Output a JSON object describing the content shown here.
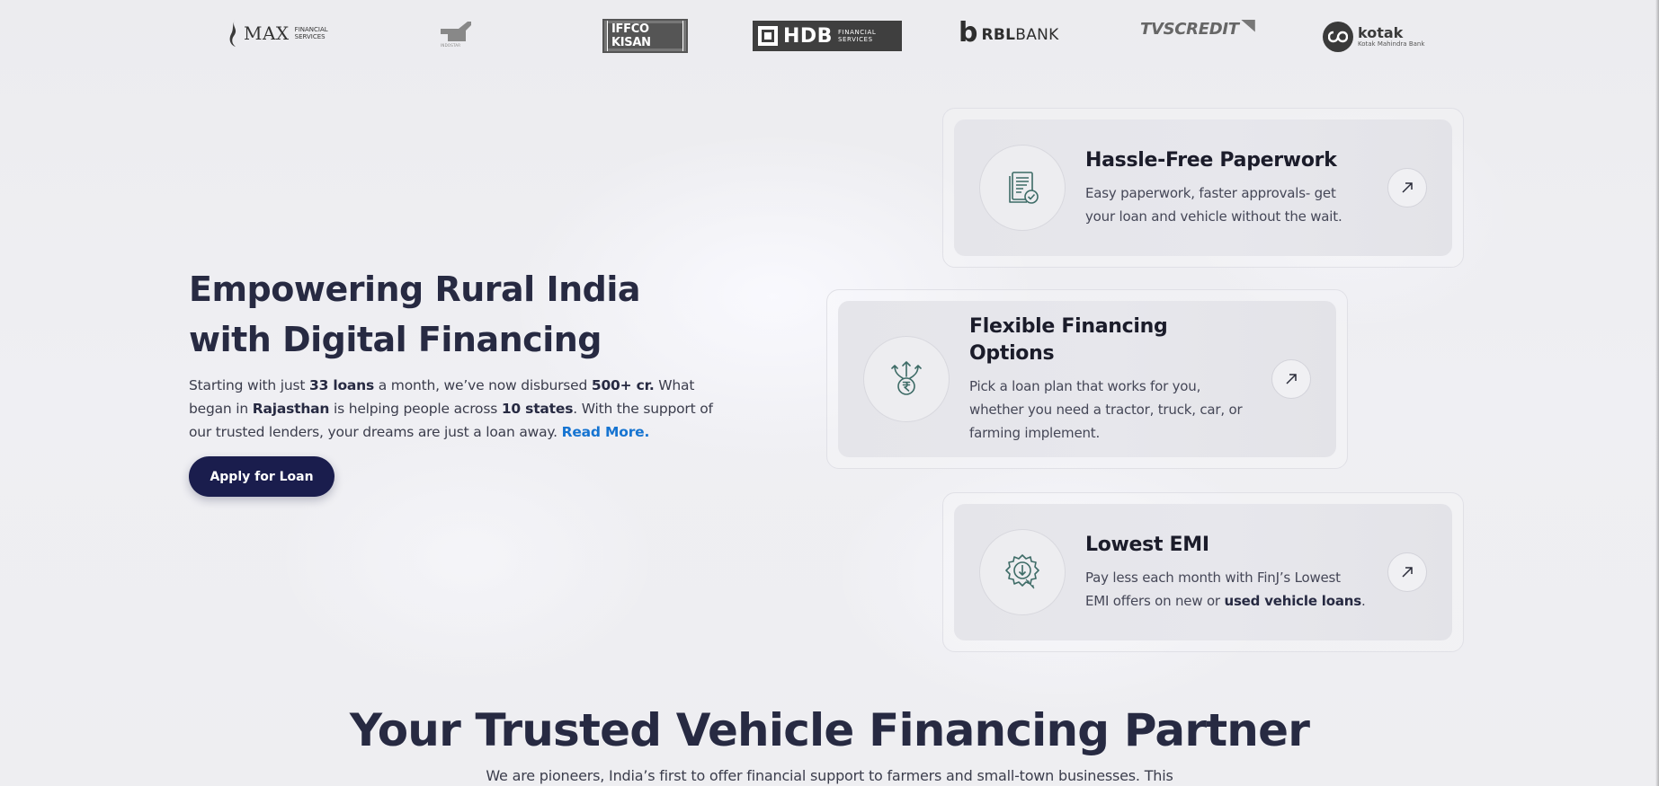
{
  "partners": {
    "max": {
      "name": "MAX",
      "sub_line1": "FINANCIAL",
      "sub_line2": "SERVICES"
    },
    "indostar": {
      "sub": "INDOSTAR"
    },
    "iffco": {
      "name": "IFFCO KISAN"
    },
    "hdb": {
      "name": "HDB",
      "sub_line1": "FINANCIAL",
      "sub_line2": "SERVICES"
    },
    "rbl": {
      "mark": "b",
      "name_bold": "RBL",
      "name_light": "BANK"
    },
    "tvs": {
      "name": "TVSCREDIT"
    },
    "kotak": {
      "name": "kotak",
      "sub": "Kotak Mahindra Bank"
    }
  },
  "hero": {
    "title_line1": "Empowering Rural India",
    "title_line2": "with Digital Financing",
    "desc": {
      "t1": "Starting with just ",
      "b1": "33 loans",
      "t2": " a month, we’ve now disbursed ",
      "b2": "500+ cr.",
      "t3": " What began in ",
      "b3": "Rajasthan",
      "t4": " is helping people across ",
      "b4": "10 states",
      "t5": ". With the support of our trusted lenders, your dreams are just a loan away. ",
      "read_more": "Read More."
    },
    "cta": "Apply for Loan"
  },
  "features": [
    {
      "title": "Hassle-Free Paperwork",
      "desc": "Easy paperwork, faster approvals- get your loan and vehicle without the wait.",
      "icon": "document-check-icon"
    },
    {
      "title": "Flexible Financing Options",
      "desc": "Pick a loan plan that works for you, whether you need a tractor, truck, car, or farming implement.",
      "icon": "rupee-options-icon"
    },
    {
      "title": "Lowest EMI",
      "desc_pre": "Pay less each month with FinJ’s Lowest EMI offers on new or ",
      "desc_bold": "used vehicle loans",
      "desc_post": ".",
      "icon": "discount-badge-icon"
    }
  ],
  "trusted": {
    "title": "Your Trusted Vehicle Financing Partner",
    "subtitle": "We are pioneers, India’s first to offer financial support to farmers and small-town businesses. This"
  },
  "colors": {
    "primary": "#1a1d4d",
    "link": "#1674d1",
    "icon_teal": "#3d6b66",
    "heading": "#272a42"
  }
}
